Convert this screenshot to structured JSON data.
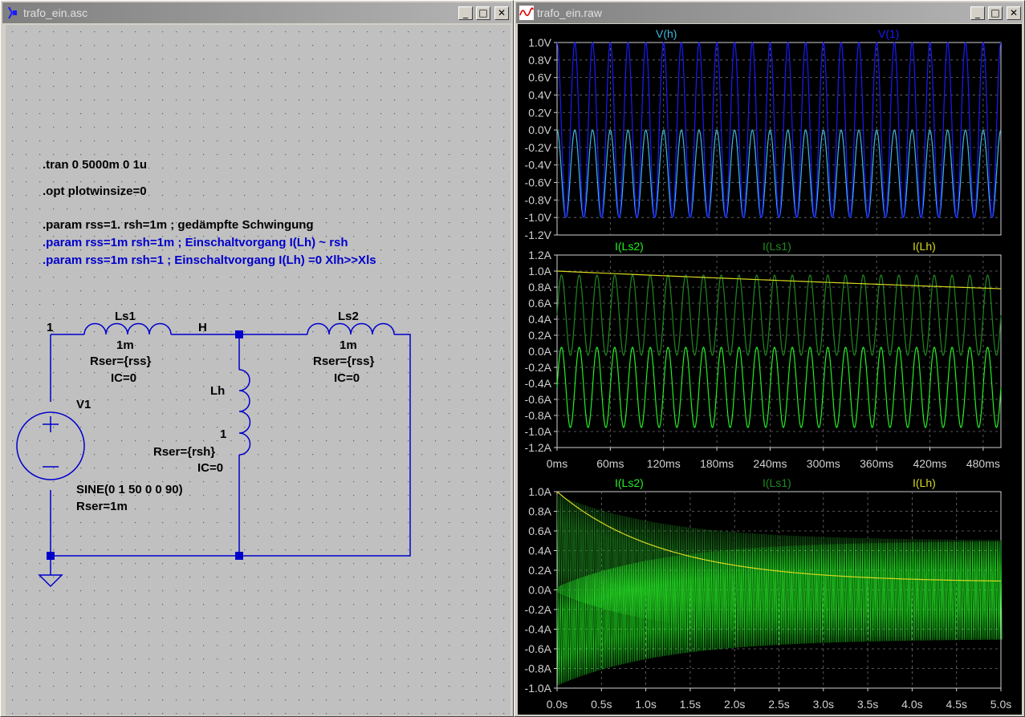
{
  "schematic_window": {
    "title": "trafo_ein.asc",
    "title_icon": "schematic-icon",
    "buttons": {
      "minimize": "_",
      "maximize": "□",
      "close": "✕"
    },
    "directives": [
      {
        "text": ".tran 0 5000m 0 1u",
        "color": "#000000"
      },
      {
        "text": ".opt plotwinsize=0",
        "color": "#000000"
      },
      {
        "text": ".param rss=1. rsh=1m ; gedämpfte Schwingung",
        "color": "#000000"
      },
      {
        "text": ".param rss=1m rsh=1m ; Einschaltvorgang I(Lh) ~ rsh",
        "color": "#0000cc"
      },
      {
        "text": ".param rss=1m rsh=1 ; Einschaltvorgang I(Lh) =0 Xlh>>Xls",
        "color": "#0000cc"
      }
    ],
    "nets": {
      "n1": "1",
      "nH": "H"
    },
    "components": {
      "ls1": {
        "name": "Ls1",
        "value": "1m",
        "rser": "Rser={rss}",
        "ic": "IC=0"
      },
      "ls2": {
        "name": "Ls2",
        "value": "1m",
        "rser": "Rser={rss}",
        "ic": "IC=0"
      },
      "lh": {
        "name": "Lh",
        "value": "1",
        "rser": "Rser={rsh}",
        "ic": "IC=0"
      },
      "v1": {
        "name": "V1",
        "value": "SINE(0 1 50 0 0 90)",
        "rser": "Rser=1m"
      }
    },
    "colors": {
      "wire": "#0000cc",
      "background": "#c0c0c0",
      "grid_dot": "#606060"
    }
  },
  "plot_window": {
    "title": "trafo_ein.raw",
    "title_icon": "waveform-icon",
    "buttons": {
      "minimize": "_",
      "maximize": "□",
      "close": "✕"
    },
    "colors": {
      "V(h)": "#3fb8e0",
      "V(1)": "#1a1aff",
      "I(Ls2)": "#22ee22",
      "I(Ls1)": "#1e8a1e",
      "I(Lh)": "#d8d820"
    }
  },
  "chart_data": [
    {
      "type": "line",
      "series": [
        {
          "name": "V(h)",
          "waveform": "sine",
          "amplitude": 0.5,
          "offset": -0.5,
          "frequency_hz": 50,
          "phase_deg": 90
        },
        {
          "name": "V(1)",
          "waveform": "sine",
          "amplitude": 1.0,
          "offset": 0,
          "frequency_hz": 50,
          "phase_deg": 90
        }
      ],
      "xlim": [
        0,
        0.5
      ],
      "ylim": [
        -1.2,
        1.0
      ],
      "ytick_labels": [
        "1.0V",
        "0.8V",
        "0.6V",
        "0.4V",
        "0.2V",
        "0.0V",
        "-0.2V",
        "-0.4V",
        "-0.6V",
        "-0.8V",
        "-1.0V",
        "-1.2V"
      ],
      "grid": true
    },
    {
      "type": "line",
      "series": [
        {
          "name": "I(Ls2)",
          "waveform": "sine",
          "amplitude": 0.5,
          "offset": -0.45,
          "frequency_hz": 50
        },
        {
          "name": "I(Ls1)",
          "waveform": "sine",
          "amplitude": 0.5,
          "offset": 0.45,
          "frequency_hz": 50
        },
        {
          "name": "I(Lh)",
          "waveform": "decay",
          "start": 1.0,
          "end": 0.78
        }
      ],
      "xlim": [
        0,
        0.5
      ],
      "ylim": [
        -1.2,
        1.2
      ],
      "ytick_labels": [
        "1.2A",
        "1.0A",
        "0.8A",
        "0.6A",
        "0.4A",
        "0.2A",
        "0.0A",
        "-0.2A",
        "-0.4A",
        "-0.6A",
        "-0.8A",
        "-1.0A",
        "-1.2A"
      ],
      "xtick_labels": [
        "0ms",
        "60ms",
        "120ms",
        "180ms",
        "240ms",
        "300ms",
        "360ms",
        "420ms",
        "480ms"
      ],
      "grid": true
    },
    {
      "type": "line",
      "series": [
        {
          "name": "I(Ls2)",
          "waveform": "envelope",
          "upper": [
            0.03,
            0.5
          ],
          "lower": [
            -0.97,
            -0.5
          ]
        },
        {
          "name": "I(Ls1)",
          "waveform": "envelope",
          "upper": [
            0.97,
            0.5
          ],
          "lower": [
            -0.03,
            -0.5
          ]
        },
        {
          "name": "I(Lh)",
          "waveform": "decay",
          "start": 1.0,
          "end": 0.09
        }
      ],
      "xlim": [
        0,
        5.0
      ],
      "ylim": [
        -1.0,
        1.0
      ],
      "ytick_labels": [
        "1.0A",
        "0.8A",
        "0.6A",
        "0.4A",
        "0.2A",
        "0.0A",
        "-0.2A",
        "-0.4A",
        "-0.6A",
        "-0.8A",
        "-1.0A"
      ],
      "xtick_labels": [
        "0.0s",
        "0.5s",
        "1.0s",
        "1.5s",
        "2.0s",
        "2.5s",
        "3.0s",
        "3.5s",
        "4.0s",
        "4.5s",
        "5.0s"
      ],
      "grid": true
    }
  ]
}
